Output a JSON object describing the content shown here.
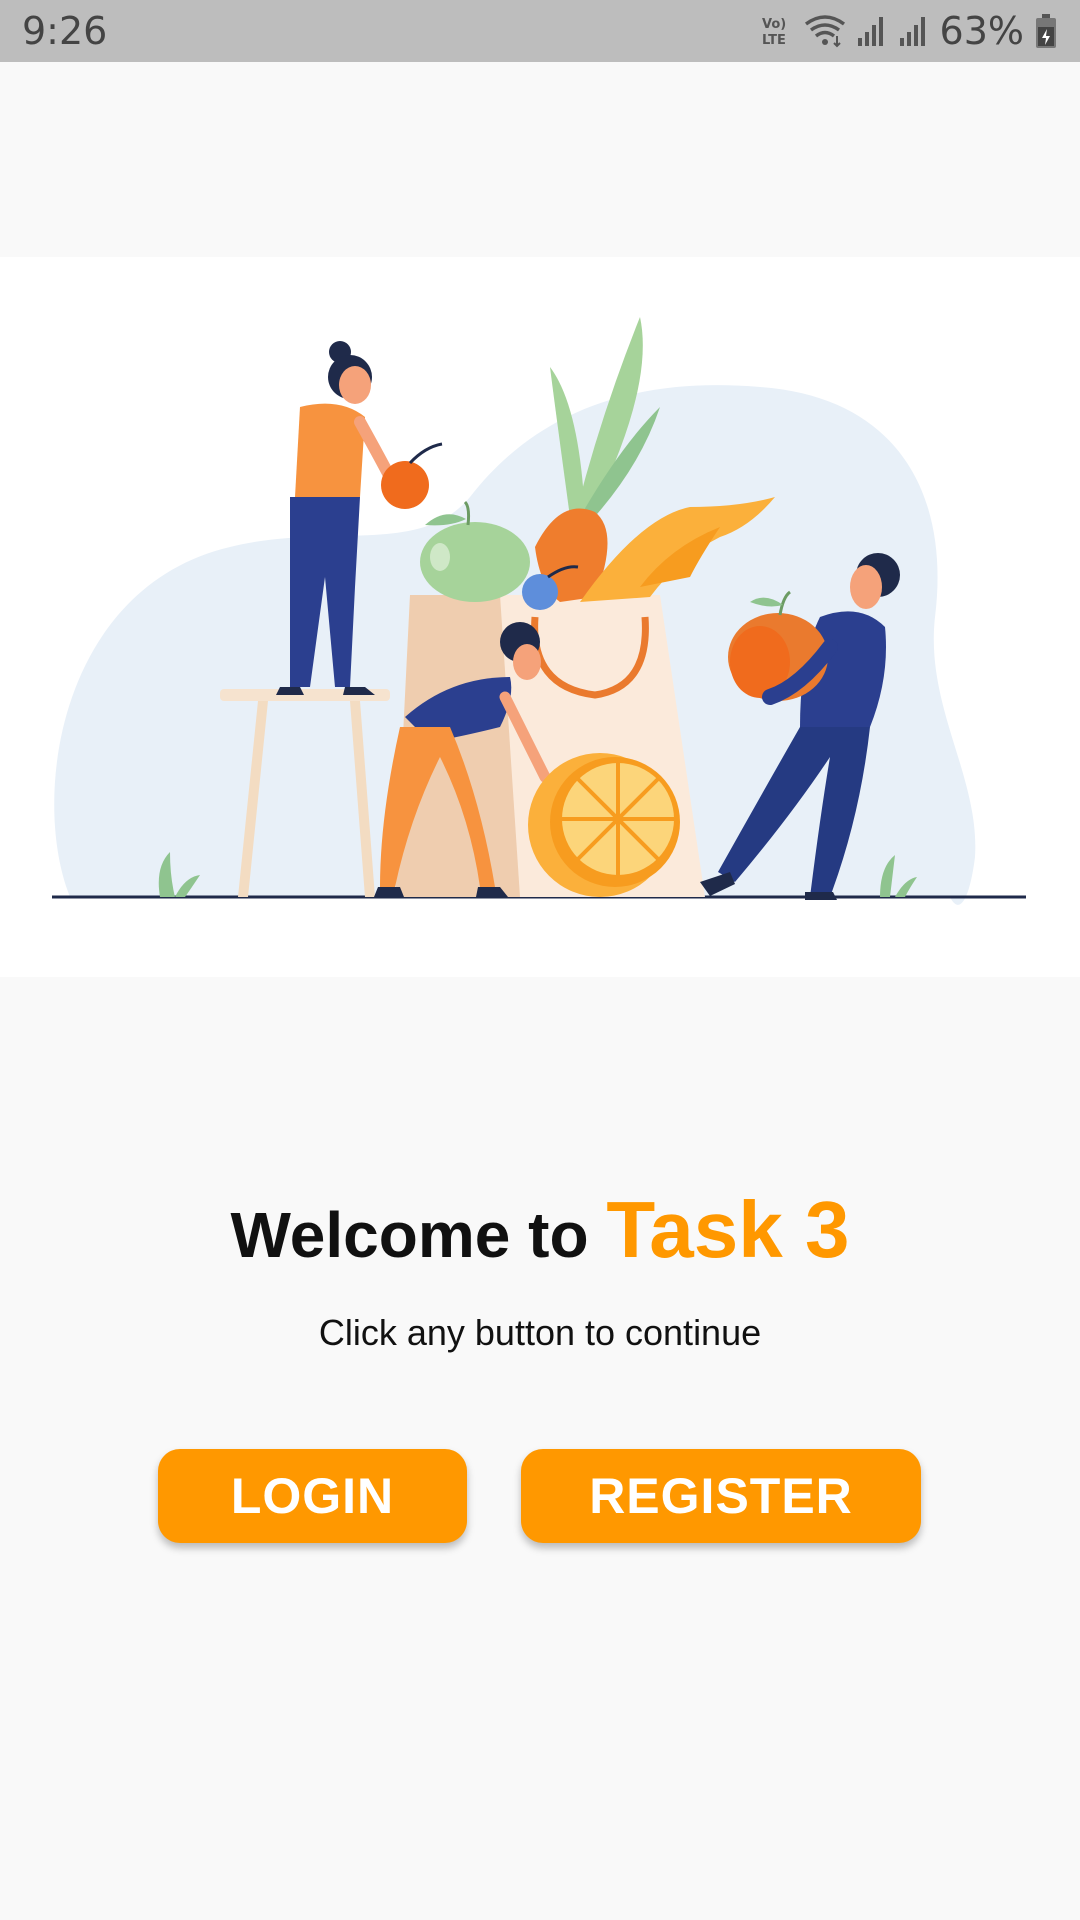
{
  "status_bar": {
    "time": "9:26",
    "battery_percent": "63%",
    "network_label": "Vo) LTE"
  },
  "welcome": {
    "prefix": "Welcome to ",
    "app_name": "Task 3",
    "subtitle": "Click any button to continue"
  },
  "buttons": {
    "login": "LOGIN",
    "register": "REGISTER"
  },
  "colors": {
    "accent": "#ff9800",
    "status_bar": "#bdbdbd",
    "background": "#f9f9f9"
  },
  "illustration": {
    "subject": "people-with-groceries-illustration"
  }
}
